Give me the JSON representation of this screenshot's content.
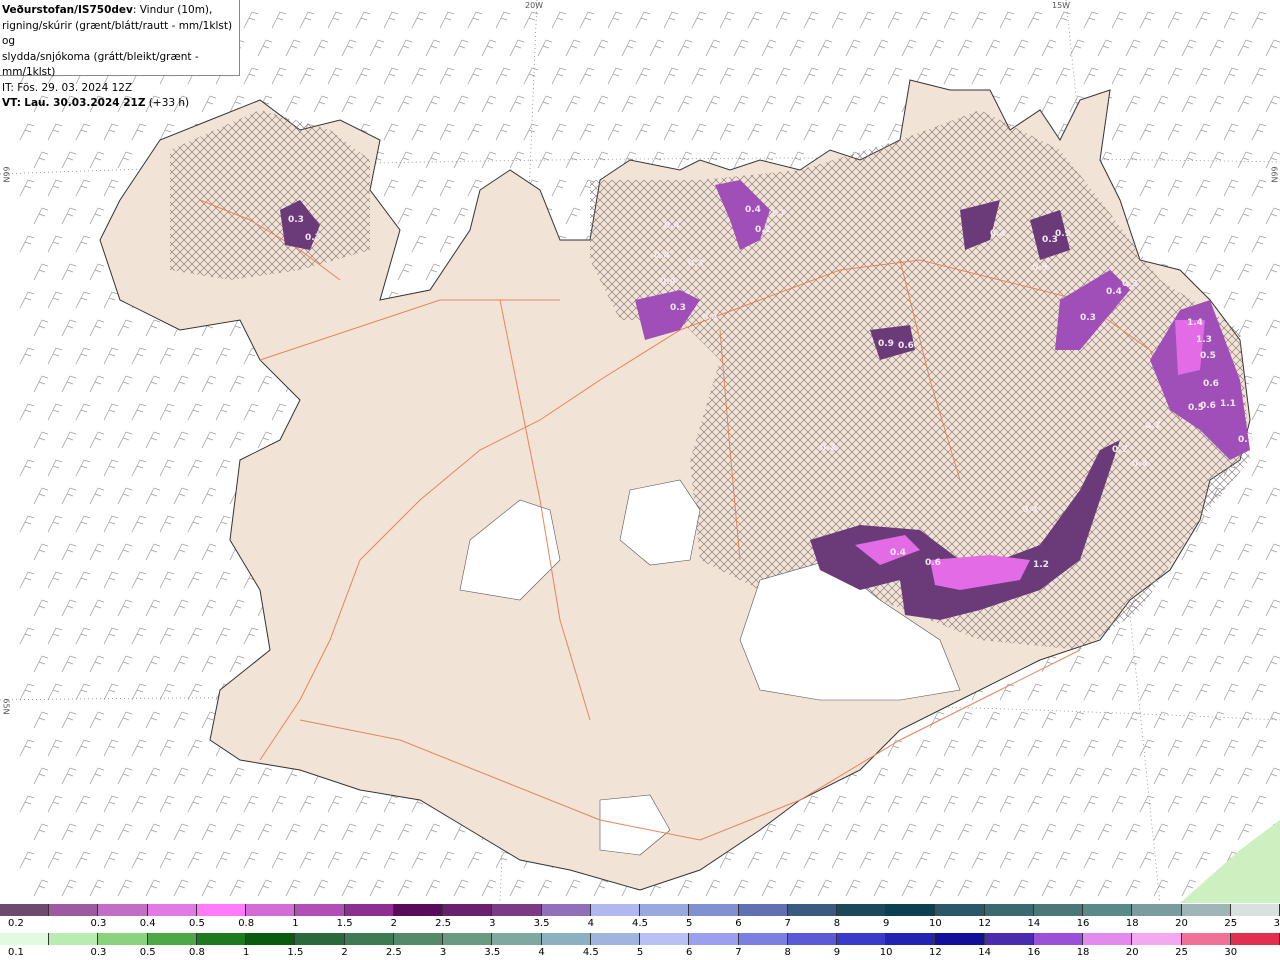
{
  "header": {
    "source": "Veðurstofan/IS750dev",
    "desc1": ": Vindur (10m),",
    "desc2": "rigning/skúrir (grænt/blátt/rautt - mm/1klst) og",
    "desc3": "slydda/snjókoma (grátt/bleikt/grænt - mm/1klst)",
    "it_line": "IT: Fös. 29. 03. 2024 12Z",
    "vt_prefix": "VT:",
    "vt_value": "Lau. 30.03.2024 21Z",
    "vt_suffix": " (+33 h)"
  },
  "grid_labels": {
    "lon_20w": "20W",
    "lon_15w": "15W",
    "lat_66n_left": "66N",
    "lat_66n_right": "66N",
    "lat_65n_left": "65N"
  },
  "colors": {
    "land": "#f1e4d7",
    "roads": "#e8845a",
    "coast": "#444444",
    "glacier": "#ffffff",
    "snow_dark": "#6b3a78",
    "snow_mid": "#a04fb8",
    "snow_bright": "#e46be6",
    "rain_light_green": "#cdf0c0"
  },
  "precip_labels": [
    "0.3",
    "0.3",
    "0.4",
    "1.7",
    "0.2",
    "0.4",
    "0.4",
    "0.3",
    "0.4",
    "0.3",
    "0.4",
    "0.4",
    "0.3",
    "0.9",
    "0.9",
    "0.4",
    "0.3",
    "0.9",
    "0.6",
    "0.3",
    "1.4",
    "1.3",
    "0.5",
    "0.6",
    "0.5",
    "1.1",
    "0.6",
    "0.7",
    "0.9",
    "0.7",
    "0.4",
    "0.2",
    "0.4",
    "0.6",
    "1.2",
    "0.4"
  ],
  "legend_snow": {
    "colors": [
      "#6e4a6e",
      "#9e5aa0",
      "#c26ec4",
      "#e07ae4",
      "#ff7cf8",
      "#d46cd8",
      "#b050b6",
      "#8c2e92",
      "#5a0a5c",
      "#6a2070",
      "#7a3a86",
      "#9070b8",
      "#b0b8f0",
      "#9aa8e0",
      "#8090d0",
      "#6070b0",
      "#3a5a80",
      "#1a4a5a",
      "#0a4050",
      "#2a5868",
      "#3a6a70",
      "#4a7878",
      "#5a8a88",
      "#7a9c9c",
      "#a0b6b6",
      "#d8e0e0"
    ],
    "labels": [
      "0.2",
      "0.3",
      "0.4",
      "0.5",
      "0.8",
      "1",
      "1.5",
      "2",
      "2.5",
      "3",
      "3.5",
      "4",
      "4.5",
      "5",
      "6",
      "7",
      "8",
      "9",
      "10",
      "12",
      "14",
      "16",
      "18",
      "20",
      "25",
      "30"
    ]
  },
  "legend_rain": {
    "colors": [
      "#e2fae0",
      "#b8ecb0",
      "#8ad27e",
      "#4ea848",
      "#1e7a1e",
      "#0a5a10",
      "#2a6a3a",
      "#3e7a52",
      "#548a68",
      "#6a9a80",
      "#7ea8a0",
      "#8cb0c0",
      "#a0b4e0",
      "#b8c0f4",
      "#9aa0ee",
      "#7a80e2",
      "#5a5ad8",
      "#3a3acc",
      "#2222b4",
      "#10109a",
      "#4a2ab0",
      "#9a50d8",
      "#e28aee",
      "#f4a8f0",
      "#f07098",
      "#e03050"
    ],
    "labels": [
      "0.1",
      "0.3",
      "0.5",
      "0.8",
      "1",
      "1.5",
      "2",
      "2.5",
      "3",
      "3.5",
      "4",
      "4.5",
      "5",
      "6",
      "7",
      "8",
      "9",
      "10",
      "12",
      "14",
      "16",
      "18",
      "20",
      "25",
      "30"
    ]
  }
}
